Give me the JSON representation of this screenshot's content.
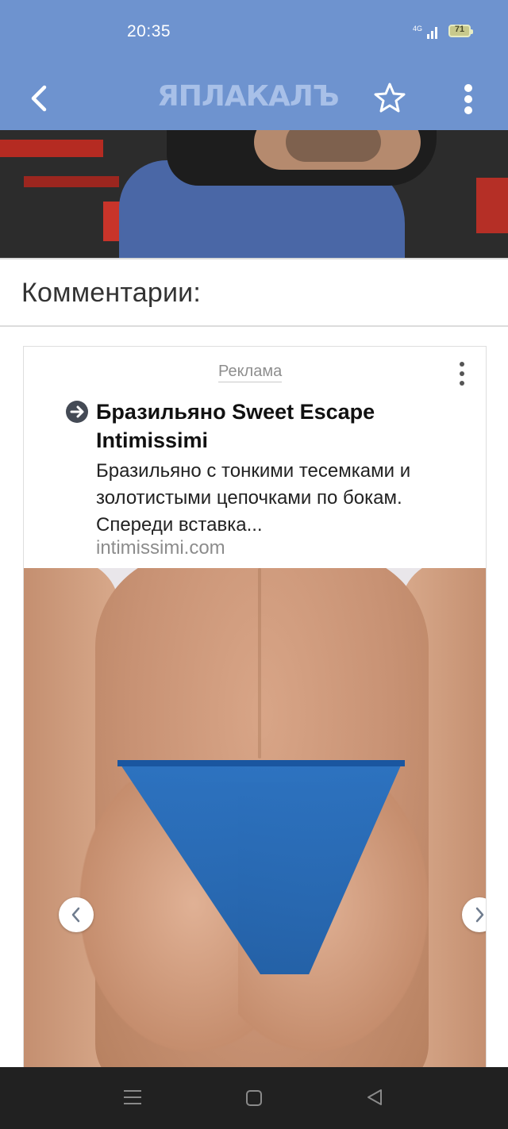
{
  "status_bar": {
    "time": "20:35",
    "network": "4G",
    "battery": "71"
  },
  "app_bar": {
    "logo_text": "ЯПЛАКАЛЪ",
    "back_icon": "chevron-left-icon",
    "favorite_icon": "star-outline-icon",
    "menu_icon": "more-vert-icon",
    "background_color": "#6e93cf"
  },
  "comments": {
    "title": "Комментарии:"
  },
  "ad": {
    "label": "Реклама",
    "title": "Бразильяно Sweet Escape Intimissimi",
    "description": "Бразильяно с тонкими тесемками и золотистыми цепочками по бокам. Спереди вставка...",
    "domain": "intimissimi.com",
    "icon": "arrow-right-circle-icon",
    "carousel": {
      "prev_icon": "chevron-left-icon",
      "next_icon": "chevron-right-icon"
    }
  },
  "system_nav": {
    "menu_icon": "menu-icon",
    "home_icon": "home-square-icon",
    "back_icon": "back-triangle-icon"
  }
}
